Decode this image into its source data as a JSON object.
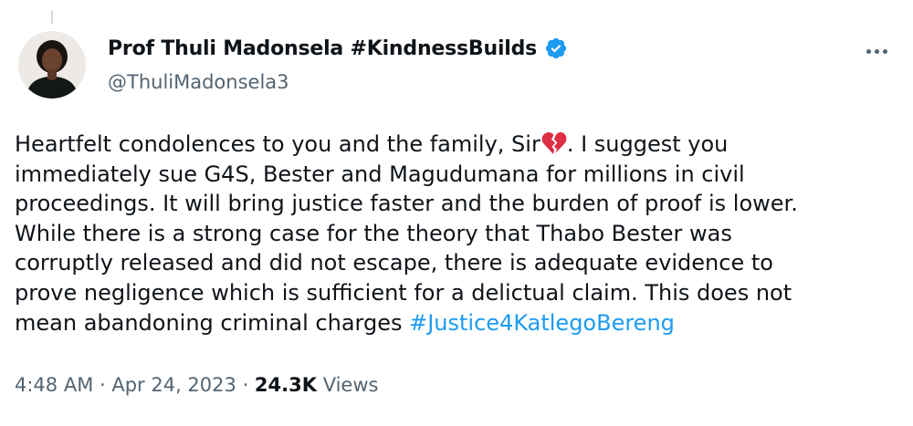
{
  "author": {
    "display_name": "Prof Thuli Madonsela #KindnessBuilds",
    "handle": "@ThuliMadonsela3",
    "verified": true,
    "avatar_icon": "profile-photo"
  },
  "tweet": {
    "lines": [
      {
        "before": "Heartfelt condolences to you and the family, Sir",
        "emoji": "broken-heart",
        "after": ". I suggest you"
      },
      {
        "text": "immediately sue G4S, Bester and Magudumana for millions in civil"
      },
      {
        "text": "proceedings. It will bring justice faster and the burden of proof is lower."
      },
      {
        "text": "While there is a strong case for the theory that Thabo Bester was"
      },
      {
        "text": "corruptly released and did not escape, there is adequate evidence to"
      },
      {
        "text": "prove negligence which is sufficient for a delictual claim. This does not"
      },
      {
        "before": "mean abandoning criminal charges ",
        "hashtag": "#Justice4KatlegoBereng"
      }
    ]
  },
  "meta": {
    "time": "4:48 AM",
    "separator": " · ",
    "date": "Apr 24, 2023",
    "views_count": "24.3K",
    "views_label": " Views"
  },
  "colors": {
    "text": "#0f1419",
    "secondary": "#536471",
    "link": "#1d9bf0",
    "verified_badge": "#1d9bf0",
    "broken_heart": "#dd2e44"
  },
  "icons": {
    "more": "more-horizontal-icon",
    "verified": "verified-badge-icon",
    "emoji": "broken-heart-icon"
  }
}
